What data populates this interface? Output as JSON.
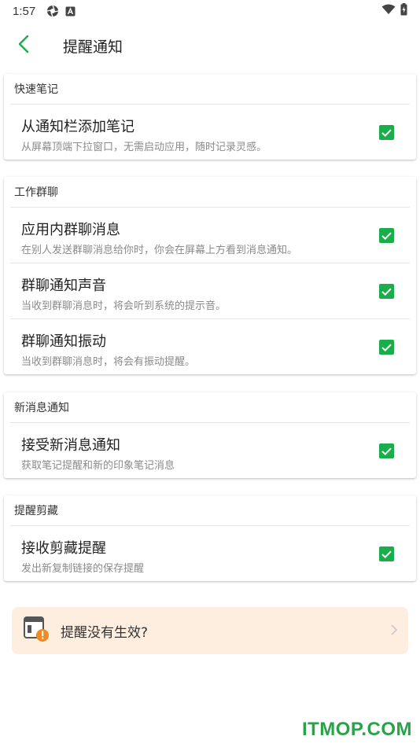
{
  "status_bar": {
    "time": "1:57",
    "left_icons": [
      "aperture-icon",
      "app-a-icon"
    ],
    "right_icons": [
      "wifi-icon",
      "battery-charging-icon"
    ]
  },
  "header": {
    "title": "提醒通知",
    "back_icon": "chevron-left-icon"
  },
  "sections": [
    {
      "title": "快速笔记",
      "items": [
        {
          "title": "从通知栏添加笔记",
          "desc": "从屏幕顶端下拉窗口，无需启动应用，随时记录灵感。",
          "checked": true
        }
      ]
    },
    {
      "title": "工作群聊",
      "items": [
        {
          "title": "应用内群聊消息",
          "desc": "在别人发送群聊消息给你时，你会在屏幕上方看到消息通知。",
          "checked": true
        },
        {
          "title": "群聊通知声音",
          "desc": "当收到群聊消息时，将会听到系统的提示音。",
          "checked": true
        },
        {
          "title": "群聊通知振动",
          "desc": "当收到群聊消息时，将会有振动提醒。",
          "checked": true
        }
      ]
    },
    {
      "title": "新消息通知",
      "items": [
        {
          "title": "接受新消息通知",
          "desc": "获取笔记提醒和新的印象笔记消息",
          "checked": true
        }
      ]
    },
    {
      "title": "提醒剪藏",
      "items": [
        {
          "title": "接收剪藏提醒",
          "desc": "发出新复制链接的保存提醒",
          "checked": true
        }
      ]
    }
  ],
  "help_banner": {
    "text": "提醒没有生效?",
    "icon": "phone-warning-icon"
  },
  "watermark": "ITMOP.COM",
  "colors": {
    "accent": "#1aad4b",
    "banner_bg": "#fdeee0",
    "warning": "#f08a24"
  }
}
